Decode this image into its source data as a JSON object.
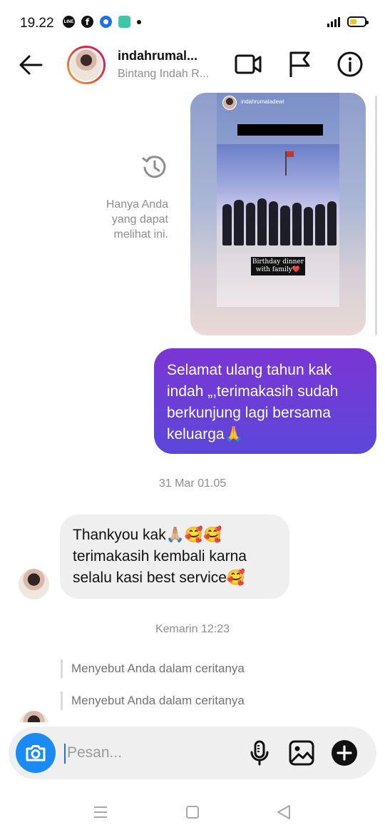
{
  "status_bar": {
    "time": "19.22",
    "app_icons": [
      "line-icon",
      "facebook-icon",
      "browser-icon",
      "app-icon"
    ],
    "battery_level": 0.45
  },
  "header": {
    "name": "indahrumal...",
    "subtitle": "Bintang Indah R...",
    "icons": [
      "back-arrow-icon",
      "video-call-icon",
      "flag-icon",
      "info-icon"
    ]
  },
  "story_reply": {
    "story_username": "indahrumaladewi",
    "story_caption_line1": "Birthday dinner",
    "story_caption_line2": "with family❤️",
    "only_you_text": "Hanya Anda yang dapat melihat ini."
  },
  "messages": {
    "outgoing_1": "Selamat ulang tahun kak indah „,terimakasih sudah berkunjung lagi bersama keluarga🙏",
    "timestamp_1": "31 Mar 01.05",
    "incoming_1": "Thankyou kak🙏🏼🥰🥰 terimakasih kembali karna selalu kasi best service🥰",
    "timestamp_2": "Kemarin 12:23",
    "mention_1": "Menyebut Anda dalam ceritanya",
    "mention_2": "Menyebut Anda dalam ceritanya"
  },
  "composer": {
    "placeholder": "Pesan...",
    "icons": [
      "camera-icon",
      "microphone-icon",
      "gallery-icon",
      "plus-icon"
    ]
  },
  "nav_bar": {
    "icons": [
      "recent-apps-icon",
      "home-icon",
      "back-icon"
    ]
  },
  "colors": {
    "outgoing_bubble_top": "#7b35d4",
    "outgoing_bubble_bottom": "#5c47da",
    "incoming_bubble": "#efefef",
    "camera_button": "#1a8af5",
    "muted_text": "#8e8e8e"
  }
}
